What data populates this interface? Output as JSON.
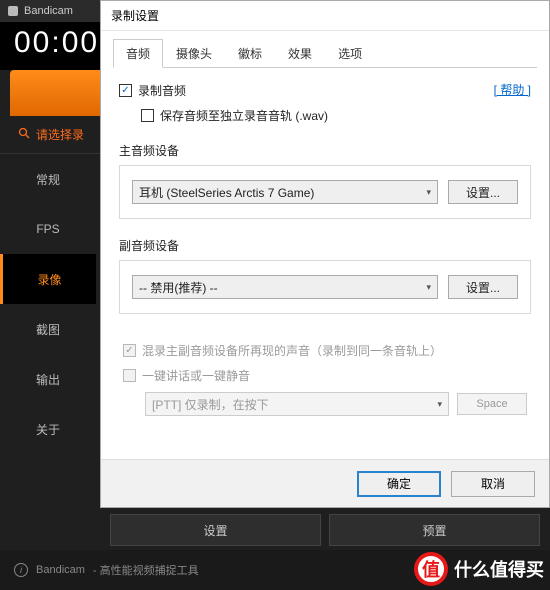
{
  "bg": {
    "app_name": "Bandicam",
    "timer": "00:00:",
    "prompt": "请选择录",
    "nav": [
      "常规",
      "FPS",
      "录像",
      "截图",
      "输出",
      "关于"
    ],
    "nav_active_index": 2,
    "bottom_buttons": [
      "设置",
      "预置"
    ],
    "status_app": "Bandicam",
    "status_text": "- 高性能视频捕捉工具",
    "watermark": "什么值得买",
    "watermark_badge": "值"
  },
  "dialog": {
    "title": "录制设置",
    "tabs": [
      "音频",
      "摄像头",
      "徽标",
      "效果",
      "选项"
    ],
    "active_tab_index": 0,
    "help": "[ 帮助 ]",
    "record_audio": "录制音频",
    "save_wav": "保存音频至独立录音音轨 (.wav)",
    "primary_label": "主音频设备",
    "primary_value": "耳机 (SteelSeries Arctis 7 Game)",
    "settings_btn": "设置...",
    "secondary_label": "副音频设备",
    "secondary_value": "-- 禁用(推荐) --",
    "mix_text": "混录主副音频设备所再现的声音（录制到同一条音轨上）",
    "ptt_label": "一键讲话或一键静音",
    "ptt_value": "[PTT] 仅录制，在按下",
    "ptt_key": "Space",
    "ok": "确定",
    "cancel": "取消"
  }
}
